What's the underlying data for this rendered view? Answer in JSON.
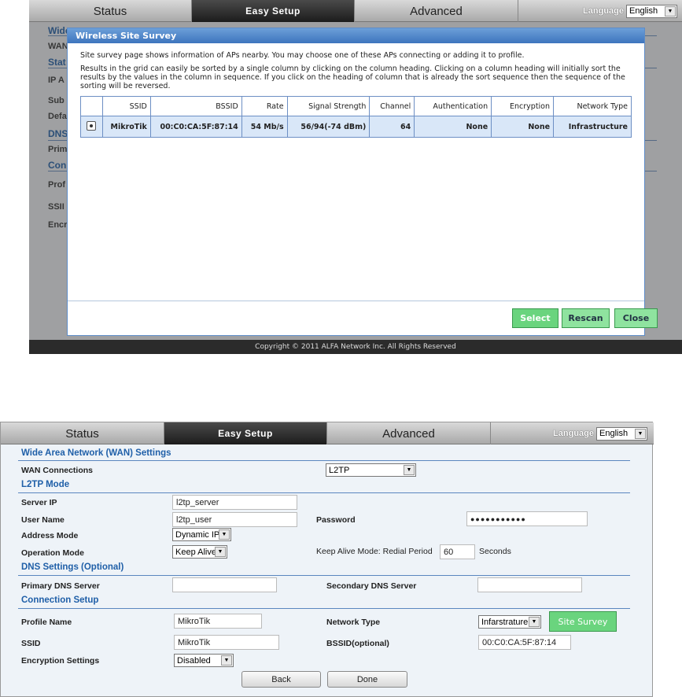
{
  "nav": {
    "tabs": [
      "Status",
      "Easy Setup",
      "Advanced"
    ],
    "language_label": "Language",
    "language_value": "English"
  },
  "background_form": {
    "wan_header": "Wide",
    "wan_row": "WAN",
    "static_header": "Stat",
    "ip": "IP A",
    "subnet": "Sub",
    "default": "Defa",
    "dns_header": "DNS",
    "primary": "Prim",
    "conn_header": "Con",
    "profile": "Prof",
    "ssid": "SSII",
    "encryption": "Encr"
  },
  "survey": {
    "title": "Wireless Site Survey",
    "intro": "Site survey page shows information of APs nearby. You may choose one of these APs connecting or adding it to profile.",
    "sort_help": "Results in the grid can easily be sorted by a single column by clicking on the column heading. Clicking on a column heading will initially sort the results by the values in the column in sequence. If you click on the heading of column that is already the sort sequence then the sequence of the sorting will be reversed.",
    "columns": [
      "",
      "SSID",
      "BSSID",
      "Rate",
      "Signal Strength",
      "Channel",
      "Authentication",
      "Encryption",
      "Network Type"
    ],
    "rows": [
      {
        "ssid": "MikroTik",
        "bssid": "00:C0:CA:5F:87:14",
        "rate": "54 Mb/s",
        "signal": "56/94(-74 dBm)",
        "channel": "64",
        "auth": "None",
        "enc": "None",
        "type": "Infrastructure"
      }
    ],
    "buttons": {
      "select": "Select",
      "rescan": "Rescan",
      "close": "Close"
    },
    "footer": "Copyright © 2011 ALFA Network Inc. All Rights Reserved"
  },
  "wan_form": {
    "wan_header": "Wide Area Network (WAN) Settings",
    "wan_connections_label": "WAN Connections",
    "wan_connections_value": "L2TP",
    "l2tp_header": "L2TP Mode",
    "server_ip_label": "Server IP",
    "server_ip_value": "l2tp_server",
    "user_name_label": "User Name",
    "user_name_value": "l2tp_user",
    "password_label": "Password",
    "password_value": "●●●●●●●●●●●",
    "address_mode_label": "Address Mode",
    "address_mode_value": "Dynamic IP",
    "operation_mode_label": "Operation Mode",
    "operation_mode_value": "Keep Alive",
    "keep_alive_label": "Keep Alive Mode: Redial Period",
    "redial_value": "60",
    "seconds_label": "Seconds",
    "dns_header": "DNS Settings (Optional)",
    "primary_dns_label": "Primary DNS Server",
    "primary_dns_value": "",
    "secondary_dns_label": "Secondary DNS Server",
    "secondary_dns_value": "",
    "conn_header": "Connection Setup",
    "profile_name_label": "Profile Name",
    "profile_name_value": "MikroTik",
    "network_type_label": "Network Type",
    "network_type_value": "Infarstrature",
    "site_survey_button": "Site Survey",
    "ssid_label": "SSID",
    "ssid_value": "MikroTik",
    "bssid_label": "BSSID(optional)",
    "bssid_value": "00:C0:CA:5F:87:14",
    "encryption_label": "Encryption Settings",
    "encryption_value": "Disabled",
    "back_button": "Back",
    "done_button": "Done"
  }
}
